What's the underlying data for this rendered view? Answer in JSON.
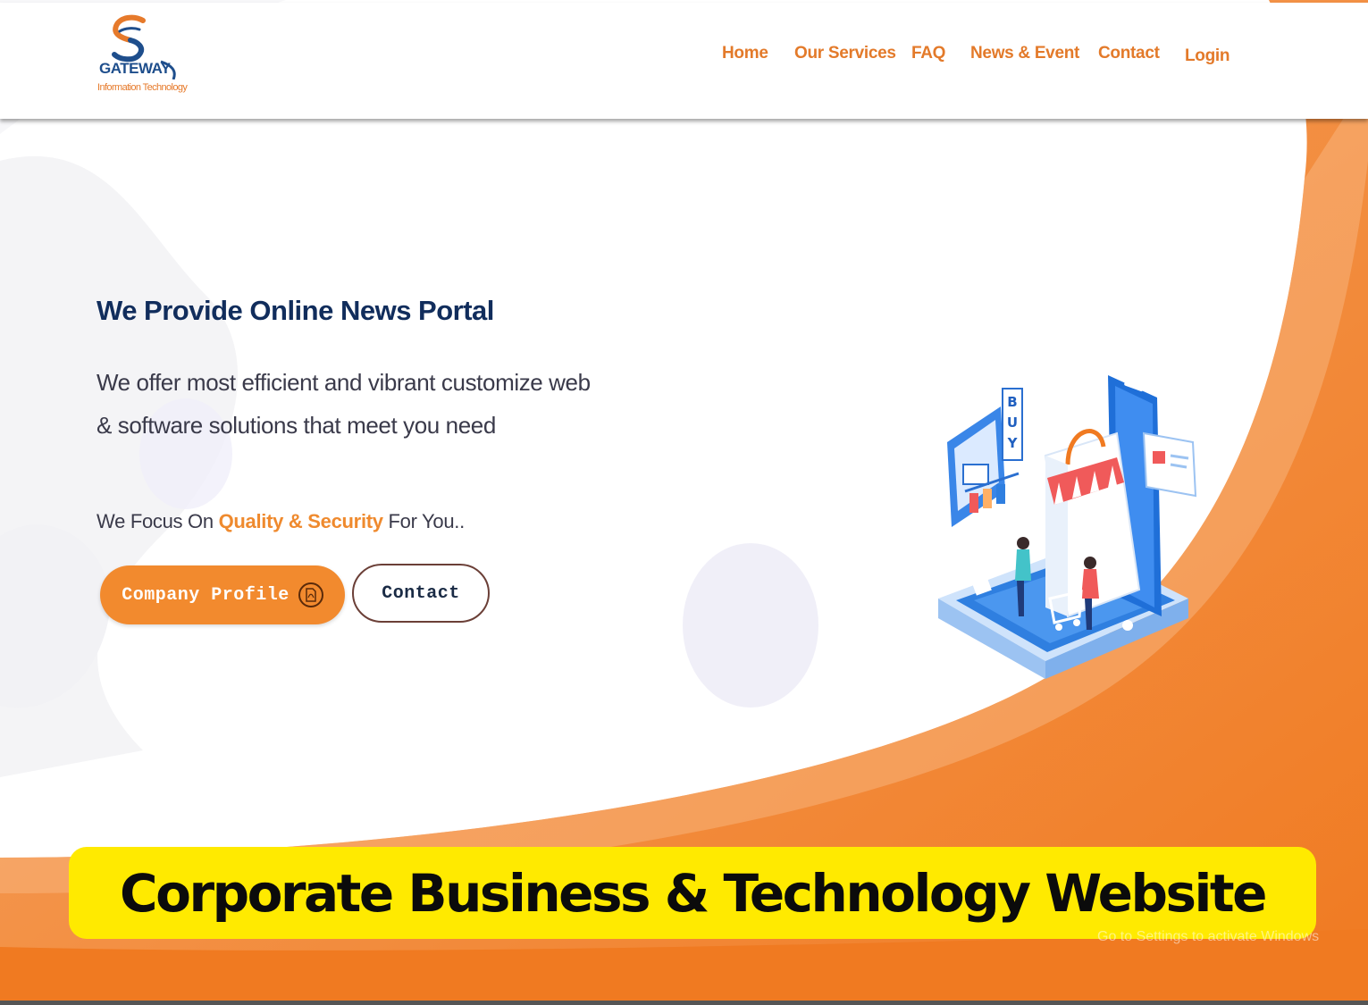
{
  "brand": {
    "name": "GATEWAY",
    "tagline": "Information Technology"
  },
  "nav": {
    "items": [
      {
        "label": "Home"
      },
      {
        "label": "Our Services"
      },
      {
        "label": "FAQ"
      },
      {
        "label": "News & Event"
      },
      {
        "label": "Contact"
      },
      {
        "label": "Login"
      }
    ]
  },
  "hero": {
    "title_strong": "We Provide",
    "title_rest": "Online News Portal",
    "desc_line1": "We offer most efficient and vibrant customize web",
    "desc_line2": "& software solutions that meet you need",
    "focus_prefix": "We Focus On",
    "focus_accent": "Quality & Security",
    "focus_suffix": "For You..",
    "illustration_word": "BUY",
    "buttons": {
      "profile_label": "Company Profile",
      "contact_label": "Contact"
    }
  },
  "banner": {
    "text": "Corporate Business & Technology Website"
  },
  "watermark": {
    "text": "Go to Settings to activate Windows"
  },
  "colors": {
    "accent_orange": "#f28a2e",
    "navy": "#112d5c",
    "banner_yellow": "#ffea00"
  },
  "icons": {
    "logo": "gateway-logo-icon",
    "pdf": "pdf-icon"
  }
}
